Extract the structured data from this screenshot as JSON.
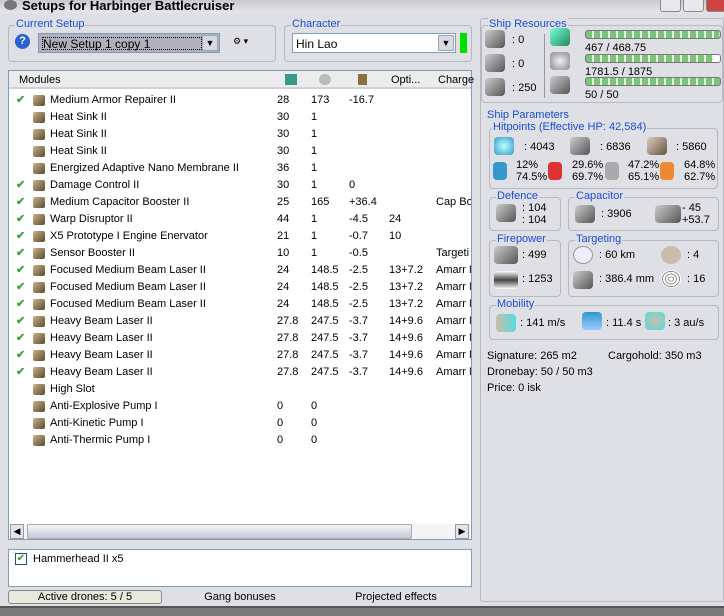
{
  "window": {
    "title": "Setups for Harbinger Battlecruiser"
  },
  "setup": {
    "group_label": "Current Setup",
    "value": "New Setup 1 copy 1"
  },
  "character": {
    "group_label": "Character",
    "value": "Hin Lao",
    "status_color": "#00e000"
  },
  "modules": {
    "headers": {
      "name": "Modules",
      "opt": "Opti...",
      "charge": "Charge"
    },
    "rows": [
      {
        "check": "✔",
        "name": "Medium Armor Repairer II",
        "cpu": "28",
        "pg": "173",
        "cap": "-16.7",
        "opt": "",
        "charge": ""
      },
      {
        "check": "",
        "name": "Heat Sink II",
        "cpu": "30",
        "pg": "1",
        "cap": "",
        "opt": "",
        "charge": ""
      },
      {
        "check": "",
        "name": "Heat Sink II",
        "cpu": "30",
        "pg": "1",
        "cap": "",
        "opt": "",
        "charge": ""
      },
      {
        "check": "",
        "name": "Heat Sink II",
        "cpu": "30",
        "pg": "1",
        "cap": "",
        "opt": "",
        "charge": ""
      },
      {
        "check": "",
        "name": "Energized Adaptive Nano Membrane II",
        "cpu": "36",
        "pg": "1",
        "cap": "",
        "opt": "",
        "charge": ""
      },
      {
        "check": "✔",
        "name": "Damage Control II",
        "cpu": "30",
        "pg": "1",
        "cap": "0",
        "opt": "",
        "charge": ""
      },
      {
        "check": "✔",
        "name": "Medium Capacitor Booster II",
        "cpu": "25",
        "pg": "165",
        "cap": "+36.4",
        "opt": "",
        "charge": "Cap Bo"
      },
      {
        "check": "✔",
        "name": "Warp Disruptor II",
        "cpu": "44",
        "pg": "1",
        "cap": "-4.5",
        "opt": "24",
        "charge": ""
      },
      {
        "check": "✔",
        "name": "X5 Prototype I Engine Enervator",
        "cpu": "21",
        "pg": "1",
        "cap": "-0.7",
        "opt": "10",
        "charge": ""
      },
      {
        "check": "✔",
        "name": "Sensor Booster II",
        "cpu": "10",
        "pg": "1",
        "cap": "-0.5",
        "opt": "",
        "charge": "Targeti"
      },
      {
        "check": "✔",
        "name": "Focused Medium Beam Laser II",
        "cpu": "24",
        "pg": "148.5",
        "cap": "-2.5",
        "opt": "13+7.2",
        "charge": "Amarr N"
      },
      {
        "check": "✔",
        "name": "Focused Medium Beam Laser II",
        "cpu": "24",
        "pg": "148.5",
        "cap": "-2.5",
        "opt": "13+7.2",
        "charge": "Amarr N"
      },
      {
        "check": "✔",
        "name": "Focused Medium Beam Laser II",
        "cpu": "24",
        "pg": "148.5",
        "cap": "-2.5",
        "opt": "13+7.2",
        "charge": "Amarr N"
      },
      {
        "check": "✔",
        "name": "Heavy Beam Laser II",
        "cpu": "27.8",
        "pg": "247.5",
        "cap": "-3.7",
        "opt": "14+9.6",
        "charge": "Amarr N"
      },
      {
        "check": "✔",
        "name": "Heavy Beam Laser II",
        "cpu": "27.8",
        "pg": "247.5",
        "cap": "-3.7",
        "opt": "14+9.6",
        "charge": "Amarr N"
      },
      {
        "check": "✔",
        "name": "Heavy Beam Laser II",
        "cpu": "27.8",
        "pg": "247.5",
        "cap": "-3.7",
        "opt": "14+9.6",
        "charge": "Amarr N"
      },
      {
        "check": "✔",
        "name": "Heavy Beam Laser II",
        "cpu": "27.8",
        "pg": "247.5",
        "cap": "-3.7",
        "opt": "14+9.6",
        "charge": "Amarr N"
      },
      {
        "check": "",
        "name": "High Slot",
        "cpu": "",
        "pg": "",
        "cap": "",
        "opt": "",
        "charge": ""
      },
      {
        "check": "",
        "name": "Anti-Explosive Pump I",
        "cpu": "0",
        "pg": "0",
        "cap": "",
        "opt": "",
        "charge": ""
      },
      {
        "check": "",
        "name": "Anti-Kinetic Pump I",
        "cpu": "0",
        "pg": "0",
        "cap": "",
        "opt": "",
        "charge": ""
      },
      {
        "check": "",
        "name": "Anti-Thermic Pump I",
        "cpu": "0",
        "pg": "0",
        "cap": "",
        "opt": "",
        "charge": ""
      }
    ]
  },
  "drones": {
    "item": "Hammerhead II x5"
  },
  "tabs": [
    "Active drones: 5 / 5",
    "Gang bonuses",
    "Projected effects"
  ],
  "resources": {
    "label": "Ship Resources",
    "turrets": ": 0",
    "launchers": ": 0",
    "calibration": ": 250",
    "cpu": "467 / 468.75",
    "cpu_fraction": 0.996,
    "powergrid": "1781.5 / 1875",
    "powergrid_fraction": 0.95,
    "drone_bw": "50 / 50",
    "drone_bw_fraction": 1.0
  },
  "params": {
    "label": "Ship Parameters",
    "hitpoints": {
      "label": "Hitpoints (Effective HP: 42,584)",
      "shield": ": 4043",
      "armor": ": 6836",
      "structure": ": 5860",
      "res": [
        [
          "12%",
          "74.5%"
        ],
        [
          "29.6%",
          "69.7%"
        ],
        [
          "47.2%",
          "65.1%"
        ],
        [
          "64.8%",
          "62.7%"
        ]
      ]
    },
    "defence": {
      "label": "Defence",
      "a": ": 104",
      "b": ": 104"
    },
    "capacitor": {
      "label": "Capacitor",
      "cap": ": 3906",
      "delta1": "- 45",
      "delta2": "+53.7"
    },
    "firepower": {
      "label": "Firepower",
      "turret": ": 499",
      "missile": ": 1253"
    },
    "targeting": {
      "label": "Targeting",
      "range": ": 60 km",
      "targets": ": 4",
      "resolution": ": 386.4 mm",
      "sensor": ": 16"
    },
    "mobility": {
      "label": "Mobility",
      "speed": ": 141 m/s",
      "align": ": 11.4 s",
      "warp": ": 3 au/s"
    },
    "signature": "Signature: 265 m2",
    "cargohold": "Cargohold: 350 m3",
    "dronebay": "Dronebay: 50 / 50 m3",
    "price": "Price: 0 isk"
  }
}
